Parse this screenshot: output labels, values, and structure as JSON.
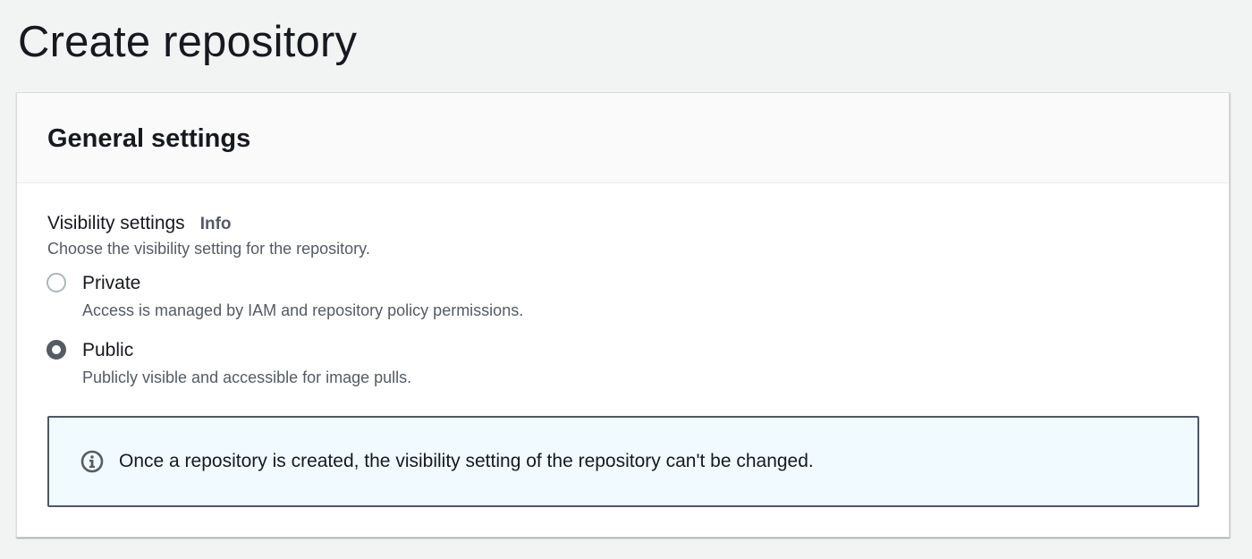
{
  "page": {
    "title": "Create repository"
  },
  "general_settings": {
    "header": "General settings",
    "visibility": {
      "label": "Visibility settings",
      "info_link": "Info",
      "description": "Choose the visibility setting for the repository.",
      "selected": "Public",
      "options": [
        {
          "label": "Private",
          "description": "Access is managed by IAM and repository policy permissions.",
          "checked": false
        },
        {
          "label": "Public",
          "description": "Publicly visible and accessible for image pulls.",
          "checked": true
        }
      ]
    },
    "alert": {
      "icon": "info-circle-icon",
      "text": "Once a repository is created, the visibility setting of the repository can't be changed."
    }
  },
  "colors": {
    "page_background": "#f2f3f3",
    "alert_background": "#f1faff",
    "alert_border": "#4a5968",
    "secondary_text": "#545b64",
    "radio_checked": "#545b64"
  }
}
